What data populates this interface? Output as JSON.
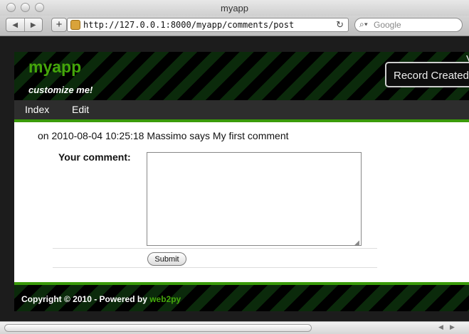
{
  "window": {
    "title": "myapp"
  },
  "toolbar": {
    "back_glyph": "◀",
    "forward_glyph": "▶",
    "add_glyph": "+",
    "url": "http://127.0.0.1:8000/myapp/comments/post",
    "reload_glyph": "↻",
    "search_placeholder": "Google",
    "search_icon_glyph": "⌕▾"
  },
  "header": {
    "logo": "myapp",
    "slogan": "customize me!",
    "flash": "Record Created",
    "flash_extra": "V"
  },
  "menu": {
    "items": [
      {
        "label": "Index"
      },
      {
        "label": "Edit"
      }
    ]
  },
  "content": {
    "comment": "on 2010-08-04 10:25:18 Massimo says My first comment",
    "form_label": "Your comment:",
    "comment_value": "",
    "submit_label": "Submit"
  },
  "footer": {
    "copyright": "Copyright © 2010 - Powered by ",
    "powered_link": "web2py"
  },
  "scrollbar": {
    "left_glyph": "◀",
    "right_glyph": "▶"
  },
  "colors": {
    "accent_green": "#3a9b0a",
    "logo_green": "#44a60a",
    "header_bg": "#000000",
    "menu_bg": "#2d2d2d"
  }
}
